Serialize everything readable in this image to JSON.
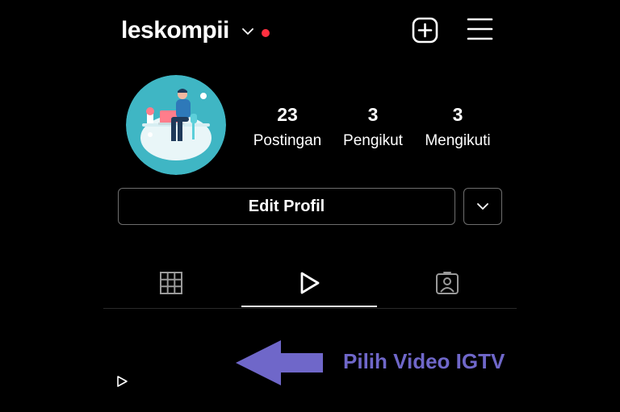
{
  "header": {
    "username": "leskompii",
    "icons": {
      "account_switch": "chevron-down-icon",
      "notification": "red-dot",
      "create": "plus-square-icon",
      "menu": "hamburger-menu-icon"
    }
  },
  "profile": {
    "avatar": "avatar-illustration",
    "stats": [
      {
        "value": "23",
        "label": "Postingan"
      },
      {
        "value": "3",
        "label": "Pengikut"
      },
      {
        "value": "3",
        "label": "Mengikuti"
      }
    ],
    "edit_button": "Edit Profil"
  },
  "tabs": [
    {
      "name": "grid",
      "icon": "grid-icon",
      "active": false
    },
    {
      "name": "igtv",
      "icon": "play-icon",
      "active": true
    },
    {
      "name": "tagged",
      "icon": "tagged-user-icon",
      "active": false
    }
  ],
  "annotation": {
    "text": "Pilih Video IGTV",
    "color": "#6f67c9"
  },
  "colors": {
    "background": "#000000",
    "text": "#ffffff",
    "notification_dot": "#ff3040",
    "avatar_bg": "#3fb6c4"
  }
}
